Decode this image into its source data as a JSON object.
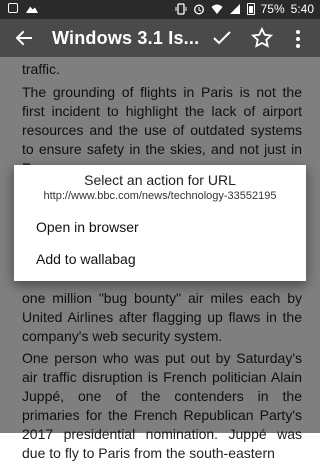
{
  "status_bar": {
    "battery_percent": "75%",
    "time": "5:40"
  },
  "app_bar": {
    "title": "Windows 3.1 Is..."
  },
  "article": {
    "paragraphs": [
      "traffic.",
      "The grounding of flights in Paris is not the first incident to highlight the lack of airport resources and the use of outdated systems to ensure safety in the skies, and not just in France.",
      "one million \"bug bounty\" air miles each by United Airlines after flagging up flaws in the company's web security system.",
      "One person who was put out by Saturday's air traffic disruption is French politician Alain Juppé, one of the contenders in the primaries for the French Republican Party's 2017 presidential nomination. Juppé was due to fly to Paris from the south-eastern"
    ]
  },
  "dialog": {
    "title": "Select an action for URL",
    "url": "http://www.bbc.com/news/technology-33552195",
    "options": [
      "Open in browser",
      "Add to wallabag"
    ]
  }
}
